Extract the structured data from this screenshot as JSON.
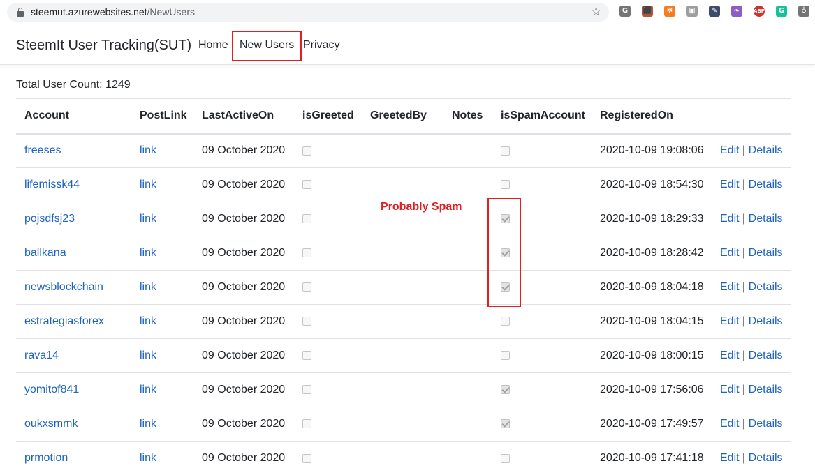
{
  "browser": {
    "url_domain": "steemut.azurewebsites.net",
    "url_path": "/NewUsers",
    "extensions": [
      {
        "icon": "g-extension-icon",
        "glyph": "G",
        "color": "#757575"
      },
      {
        "icon": "pdf-icon",
        "glyph": "⬛",
        "color": "#b5533c"
      },
      {
        "icon": "orange-circle-icon",
        "glyph": "✻",
        "color": "#f57c1f"
      },
      {
        "icon": "screen-icon",
        "glyph": "▣",
        "color": "#9e9e9e"
      },
      {
        "icon": "eyedropper-icon",
        "glyph": "✎",
        "color": "#3c4a6b"
      },
      {
        "icon": "feather-icon",
        "glyph": "❧",
        "color": "#8e5cc7"
      },
      {
        "icon": "adblock-icon",
        "glyph": "ABP",
        "color": "#d32f2f"
      },
      {
        "icon": "grammarly-icon",
        "glyph": "G",
        "color": "#15c39a"
      },
      {
        "icon": "bulb-icon",
        "glyph": "♁",
        "color": "#757575"
      }
    ]
  },
  "navbar": {
    "brand": "SteemIt User Tracking(SUT)",
    "links": [
      "Home",
      "New Users",
      "Privacy"
    ]
  },
  "summary": {
    "total_label": "Total User Count: 1249"
  },
  "table": {
    "headers": [
      "Account",
      "PostLink",
      "LastActiveOn",
      "isGreeted",
      "GreetedBy",
      "Notes",
      "isSpamAccount",
      "RegisteredOn",
      ""
    ],
    "rows": [
      {
        "account": "freeses",
        "postlink": "link",
        "last_active": "09 October 2020",
        "is_greeted": false,
        "greeted_by": "",
        "notes": "",
        "is_spam": false,
        "registered": "2020-10-09 19:08:06"
      },
      {
        "account": "lifemissk44",
        "postlink": "link",
        "last_active": "09 October 2020",
        "is_greeted": false,
        "greeted_by": "",
        "notes": "",
        "is_spam": false,
        "registered": "2020-10-09 18:54:30"
      },
      {
        "account": "pojsdfsj23",
        "postlink": "link",
        "last_active": "09 October 2020",
        "is_greeted": false,
        "greeted_by": "",
        "notes": "",
        "is_spam": true,
        "registered": "2020-10-09 18:29:33"
      },
      {
        "account": "ballkana",
        "postlink": "link",
        "last_active": "09 October 2020",
        "is_greeted": false,
        "greeted_by": "",
        "notes": "",
        "is_spam": true,
        "registered": "2020-10-09 18:28:42"
      },
      {
        "account": "newsblockchain",
        "postlink": "link",
        "last_active": "09 October 2020",
        "is_greeted": false,
        "greeted_by": "",
        "notes": "",
        "is_spam": true,
        "registered": "2020-10-09 18:04:18"
      },
      {
        "account": "estrategiasforex",
        "postlink": "link",
        "last_active": "09 October 2020",
        "is_greeted": false,
        "greeted_by": "",
        "notes": "",
        "is_spam": false,
        "registered": "2020-10-09 18:04:15"
      },
      {
        "account": "rava14",
        "postlink": "link",
        "last_active": "09 October 2020",
        "is_greeted": false,
        "greeted_by": "",
        "notes": "",
        "is_spam": false,
        "registered": "2020-10-09 18:00:15"
      },
      {
        "account": "yomitof841",
        "postlink": "link",
        "last_active": "09 October 2020",
        "is_greeted": false,
        "greeted_by": "",
        "notes": "",
        "is_spam": true,
        "registered": "2020-10-09 17:56:06"
      },
      {
        "account": "oukxsmmk",
        "postlink": "link",
        "last_active": "09 October 2020",
        "is_greeted": false,
        "greeted_by": "",
        "notes": "",
        "is_spam": true,
        "registered": "2020-10-09 17:49:57"
      },
      {
        "account": "prmotion",
        "postlink": "link",
        "last_active": "09 October 2020",
        "is_greeted": false,
        "greeted_by": "",
        "notes": "",
        "is_spam": false,
        "registered": "2020-10-09 17:41:18"
      }
    ],
    "actions": {
      "edit_label": "Edit",
      "separator": "|",
      "details_label": "Details"
    }
  },
  "annotation": {
    "text": "Probably Spam",
    "color": "#e02020"
  }
}
